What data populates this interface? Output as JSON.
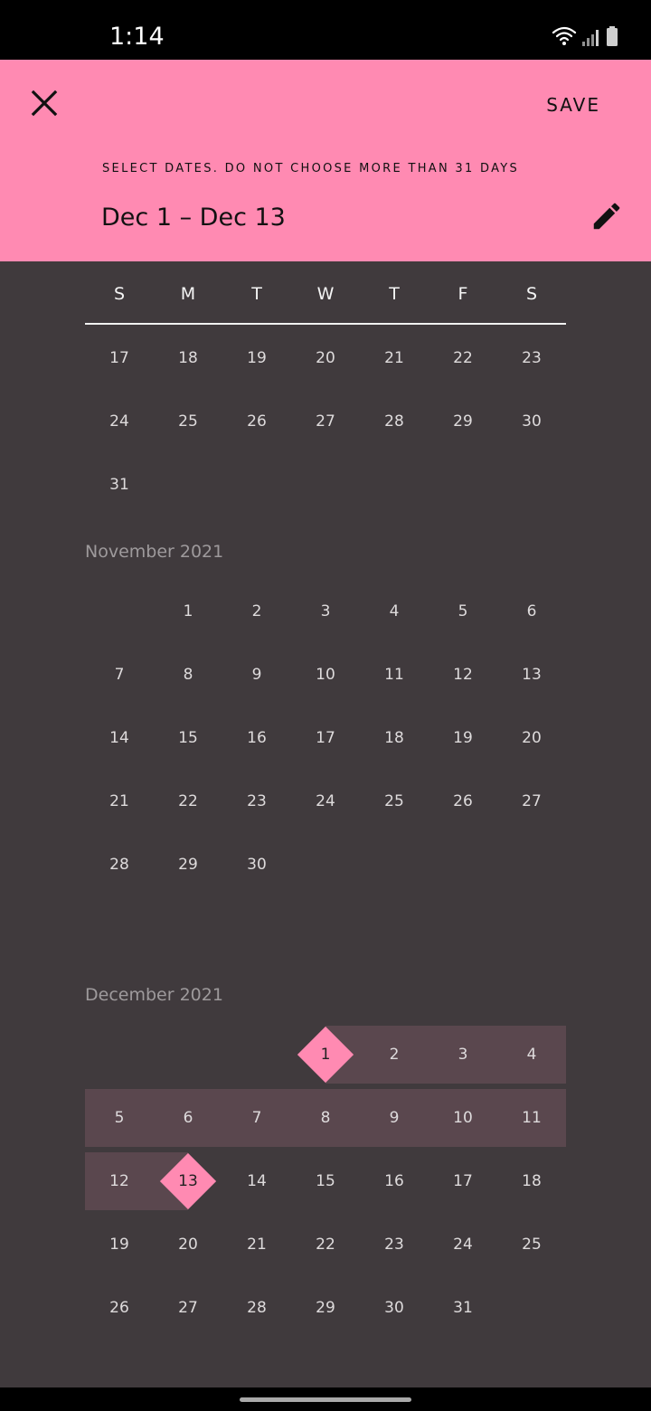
{
  "status_bar": {
    "time": "1:14"
  },
  "header": {
    "close_icon": "close-icon",
    "save_label": "SAVE",
    "helper": "SELECT DATES. DO NOT CHOOSE MORE THAN 31 DAYS",
    "range": "Dec 1 – Dec 13",
    "edit_icon": "pencil-icon",
    "accent": "#ff8ab2"
  },
  "weekdays": [
    "S",
    "M",
    "T",
    "W",
    "T",
    "F",
    "S"
  ],
  "months": [
    {
      "label": "",
      "weeks": [
        [
          "17",
          "18",
          "19",
          "20",
          "21",
          "22",
          "23"
        ],
        [
          "24",
          "25",
          "26",
          "27",
          "28",
          "29",
          "30"
        ],
        [
          "31",
          "",
          "",
          "",
          "",
          "",
          ""
        ]
      ]
    },
    {
      "label": "November 2021",
      "weeks": [
        [
          "",
          "1",
          "2",
          "3",
          "4",
          "5",
          "6"
        ],
        [
          "7",
          "8",
          "9",
          "10",
          "11",
          "12",
          "13"
        ],
        [
          "14",
          "15",
          "16",
          "17",
          "18",
          "19",
          "20"
        ],
        [
          "21",
          "22",
          "23",
          "24",
          "25",
          "26",
          "27"
        ],
        [
          "28",
          "29",
          "30",
          "",
          "",
          "",
          ""
        ]
      ]
    },
    {
      "label": "December 2021",
      "weeks": [
        [
          "",
          "",
          "",
          "1",
          "2",
          "3",
          "4"
        ],
        [
          "5",
          "6",
          "7",
          "8",
          "9",
          "10",
          "11"
        ],
        [
          "12",
          "13",
          "14",
          "15",
          "16",
          "17",
          "18"
        ],
        [
          "19",
          "20",
          "21",
          "22",
          "23",
          "24",
          "25"
        ],
        [
          "26",
          "27",
          "28",
          "29",
          "30",
          "31",
          ""
        ]
      ],
      "range_start": "1",
      "range_end": "13"
    }
  ],
  "colors": {
    "background": "#403a3d",
    "range_fill": "#5a474e",
    "selected": "#ff8ab2"
  }
}
